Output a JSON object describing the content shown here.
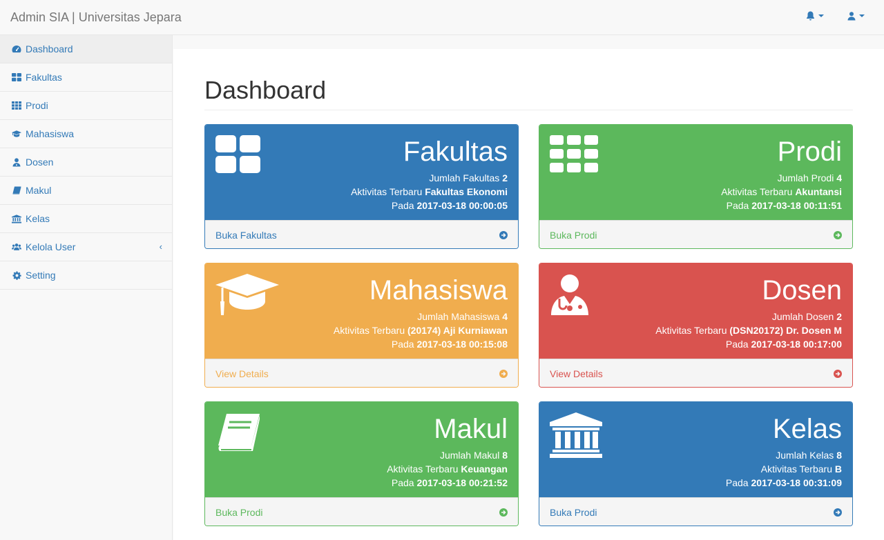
{
  "colors": {
    "primary": "#337ab7",
    "success": "#5cb85c",
    "warning": "#f0ad4e",
    "danger": "#d9534f"
  },
  "navbar": {
    "brand": "Admin SIA | Universitas Jepara",
    "icons": [
      "bell-icon",
      "user-icon"
    ]
  },
  "sidebar": {
    "items": [
      {
        "label": "Dashboard",
        "icon": "dashboard-icon"
      },
      {
        "label": "Fakultas",
        "icon": "th-large-icon"
      },
      {
        "label": "Prodi",
        "icon": "th-icon"
      },
      {
        "label": "Mahasiswa",
        "icon": "graduation-cap-icon"
      },
      {
        "label": "Dosen",
        "icon": "user-md-icon"
      },
      {
        "label": "Makul",
        "icon": "book-icon"
      },
      {
        "label": "Kelas",
        "icon": "institution-icon"
      },
      {
        "label": "Kelola User",
        "icon": "users-icon",
        "arrow": "‹"
      },
      {
        "label": "Setting",
        "icon": "gear-icon"
      }
    ]
  },
  "main": {
    "title": "Dashboard",
    "panels": [
      {
        "title": "Fakultas",
        "icon": "th-large-icon",
        "l1_pre": "Jumlah Fakultas ",
        "l1_val": "2",
        "l2_pre": "Aktivitas Terbaru ",
        "l2_val": "Fakultas Ekonomi",
        "l3_pre": "Pada ",
        "l3_val": "2017-03-18 00:00:05",
        "footer": "Buka Fakultas"
      },
      {
        "title": "Prodi",
        "icon": "th-icon",
        "l1_pre": "Jumlah Prodi ",
        "l1_val": "4",
        "l2_pre": "Aktivitas Terbaru ",
        "l2_val": "Akuntansi",
        "l3_pre": "Pada ",
        "l3_val": "2017-03-18 00:11:51",
        "footer": "Buka Prodi"
      },
      {
        "title": "Mahasiswa",
        "icon": "graduation-cap-icon",
        "l1_pre": "Jumlah Mahasiswa ",
        "l1_val": "4",
        "l2_pre": "Aktivitas Terbaru ",
        "l2_val": "(20174) Aji Kurniawan",
        "l3_pre": "Pada ",
        "l3_val": "2017-03-18 00:15:08",
        "footer": "View Details"
      },
      {
        "title": "Dosen",
        "icon": "user-md-icon",
        "l1_pre": "Jumlah Dosen ",
        "l1_val": "2",
        "l2_pre": "Aktivitas Terbaru ",
        "l2_val": "(DSN20172) Dr. Dosen M",
        "l3_pre": "Pada ",
        "l3_val": "2017-03-18 00:17:00",
        "footer": "View Details"
      },
      {
        "title": "Makul",
        "icon": "book-icon",
        "l1_pre": "Jumlah Makul ",
        "l1_val": "8",
        "l2_pre": "Aktivitas Terbaru ",
        "l2_val": "Keuangan",
        "l3_pre": "Pada ",
        "l3_val": "2017-03-18 00:21:52",
        "footer": "Buka Prodi"
      },
      {
        "title": "Kelas",
        "icon": "institution-icon",
        "l1_pre": "Jumlah Kelas ",
        "l1_val": "8",
        "l2_pre": "Aktivitas Terbaru ",
        "l2_val": "B",
        "l3_pre": "Pada ",
        "l3_val": "2017-03-18 00:31:09",
        "footer": "Buka Prodi"
      }
    ]
  }
}
